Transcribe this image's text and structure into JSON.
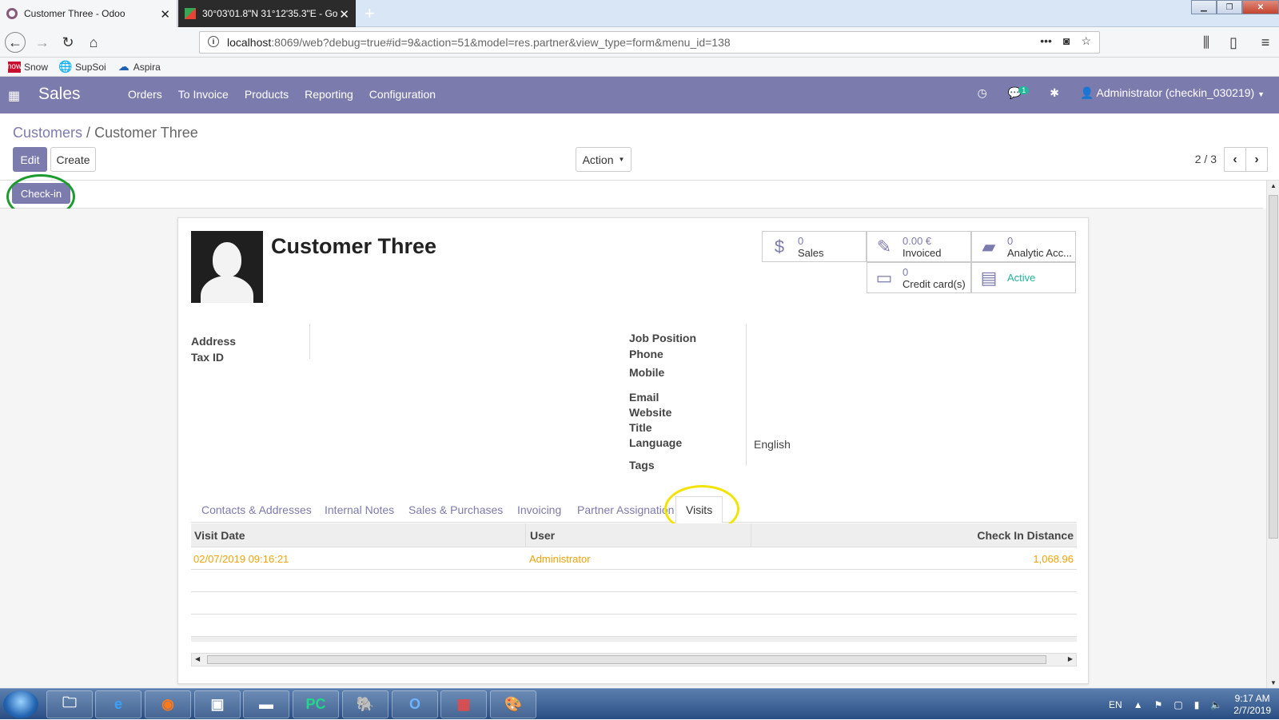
{
  "browser": {
    "tabs": [
      {
        "title": "Customer Three - Odoo"
      },
      {
        "title": "30°03'01.8\"N 31°12'35.3\"E - Goo"
      }
    ],
    "url_host": "localhost",
    "url_rest": ":8069/web?debug=true#id=9&action=51&model=res.partner&view_type=form&menu_id=138",
    "bookmarks": [
      "Snow",
      "SupSoi",
      "Aspira"
    ]
  },
  "odoo_nav": {
    "app": "Sales",
    "menu": [
      "Orders",
      "To Invoice",
      "Products",
      "Reporting",
      "Configuration"
    ],
    "message_count": "1",
    "user": "Administrator (checkin_030219)"
  },
  "breadcrumb": {
    "parent": "Customers",
    "separator": "/",
    "current": "Customer Three"
  },
  "buttons": {
    "edit": "Edit",
    "create": "Create",
    "action": "Action",
    "checkin": "Check-in"
  },
  "pager": {
    "value": "2 / 3"
  },
  "record": {
    "name": "Customer Three",
    "smart_buttons": {
      "sales": {
        "value": "0",
        "label": "Sales"
      },
      "invoiced": {
        "value": "0.00 €",
        "label": "Invoiced"
      },
      "analytic": {
        "value": "0",
        "label": "Analytic Acc..."
      },
      "credit": {
        "value": "0",
        "label": "Credit card(s)"
      },
      "active": {
        "label": "Active"
      }
    },
    "left_labels": {
      "address": "Address",
      "tax_id": "Tax ID"
    },
    "right_labels": {
      "job_position": "Job Position",
      "phone": "Phone",
      "mobile": "Mobile",
      "email": "Email",
      "website": "Website",
      "title": "Title",
      "language": "Language",
      "tags": "Tags"
    },
    "language_value": "English"
  },
  "notebook": {
    "tabs": [
      "Contacts & Addresses",
      "Internal Notes",
      "Sales & Purchases",
      "Invoicing",
      "Partner Assignation",
      "Visits"
    ],
    "active": "Visits"
  },
  "visits_table": {
    "columns": [
      "Visit Date",
      "User",
      "Check In Distance"
    ],
    "rows": [
      {
        "date": "02/07/2019 09:16:21",
        "user": "Administrator",
        "distance": "1,068.96"
      }
    ]
  },
  "taskbar": {
    "lang": "EN",
    "time": "9:17 AM",
    "date": "2/7/2019"
  },
  "colors": {
    "odoo_primary": "#7c7bad",
    "row_text": "#f0a30a",
    "active_green": "#21b799",
    "annotation_green": "#1c9b2f",
    "annotation_yellow": "#f2e400"
  }
}
